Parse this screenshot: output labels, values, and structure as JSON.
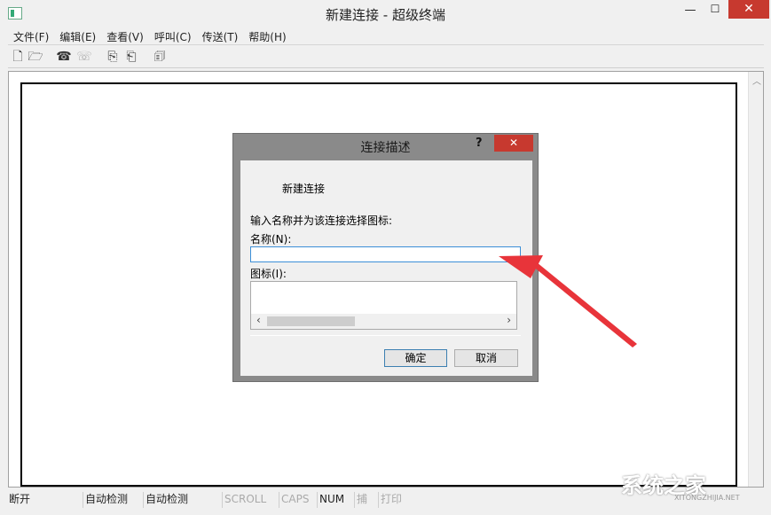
{
  "window": {
    "title": "新建连接 - 超级终端",
    "min_glyph": "—",
    "max_glyph": "☐",
    "close_glyph": "✕"
  },
  "menubar": [
    "文件(F)",
    "编辑(E)",
    "查看(V)",
    "呼叫(C)",
    "传送(T)",
    "帮助(H)"
  ],
  "toolbar": {
    "icons": [
      "new-icon",
      "open-icon",
      "call-icon",
      "disconnect-icon",
      "send-icon",
      "receive-icon",
      "properties-icon"
    ]
  },
  "dialog": {
    "title": "连接描述",
    "help_glyph": "?",
    "close_glyph": "✕",
    "connection_name": "新建连接",
    "prompt": "输入名称并为该连接选择图标:",
    "name_label": "名称(N):",
    "name_value": "",
    "icon_label": "图标(I):",
    "ok_label": "确定",
    "cancel_label": "取消"
  },
  "statusbar": {
    "cells": [
      {
        "text": "断开",
        "dim": false
      },
      {
        "text": "自动检测",
        "dim": false
      },
      {
        "text": "自动检测",
        "dim": false
      },
      {
        "text": "SCROLL",
        "dim": true
      },
      {
        "text": "CAPS",
        "dim": true
      },
      {
        "text": "NUM",
        "dim": false
      },
      {
        "text": "捕",
        "dim": true
      },
      {
        "text": "打印",
        "dim": true
      }
    ]
  },
  "watermark": {
    "text": "系统之家",
    "sub": "XITONGZHIJIA.NET"
  },
  "colors": {
    "accent": "#3c8fd8",
    "close": "#c7392f",
    "arrow": "#e8343a"
  }
}
